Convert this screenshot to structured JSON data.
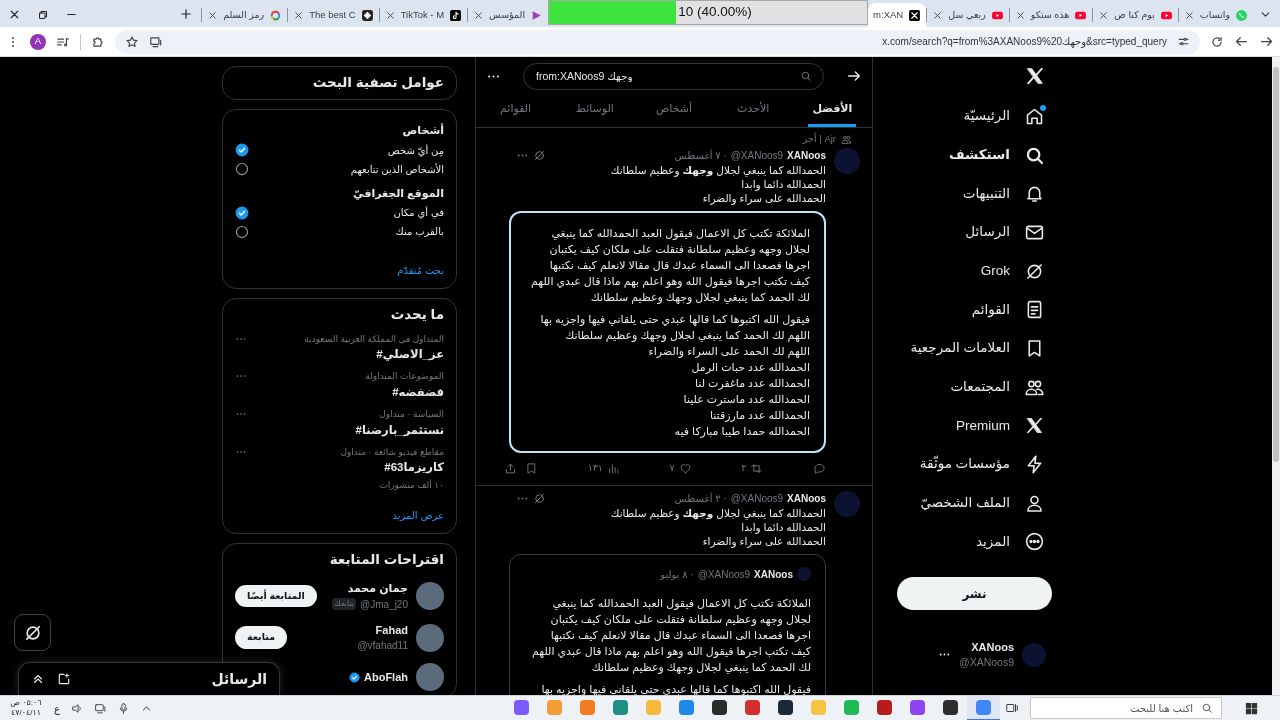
{
  "browser": {
    "tabs": [
      {
        "title": "واتساب",
        "selected": false
      },
      {
        "title": "يوم كنا ص",
        "selected": false
      },
      {
        "title": "هذه ستكو",
        "selected": false
      },
      {
        "title": "ربعي سل",
        "selected": false
      },
      {
        "title": "m:XAN",
        "selected": true
      },
      {
        "title": "المؤسس",
        "selected": false
      },
      {
        "title": "TikTok - M",
        "selected": false
      },
      {
        "title": "The best C",
        "selected": false
      },
      {
        "title": "رمز السلم",
        "selected": false
      }
    ],
    "progress": {
      "label": "10 (40.00%)",
      "level": 0.4
    },
    "url": "x.com/search?q=from%3AXANoos9%20وجهك&src=typed_query",
    "profile_initial": "A"
  },
  "nav": {
    "items": [
      {
        "label": "الرئيسيّة",
        "selected": false,
        "unread": true
      },
      {
        "label": "استكشف",
        "selected": true,
        "unread": false
      },
      {
        "label": "التنبيهات",
        "selected": false,
        "unread": false
      },
      {
        "label": "الرسائل",
        "selected": false,
        "unread": false
      },
      {
        "label": "Grok",
        "selected": false,
        "unread": false
      },
      {
        "label": "القوائم",
        "selected": false,
        "unread": false
      },
      {
        "label": "العلامات المرجعية",
        "selected": false,
        "unread": false
      },
      {
        "label": "المجتمعات",
        "selected": false,
        "unread": false
      },
      {
        "label": "Premium",
        "selected": false,
        "unread": false
      },
      {
        "label": "مؤسسات موثّقة",
        "selected": false,
        "unread": false
      },
      {
        "label": "الملف الشخصيّ",
        "selected": false,
        "unread": false
      },
      {
        "label": "المزيد",
        "selected": false,
        "unread": false
      }
    ],
    "post_button": "نشر",
    "account": {
      "name": "XANoos",
      "handle": "@XANoos9"
    }
  },
  "search": {
    "query": "from:XANoos9 وجهك",
    "tabs": [
      {
        "label": "الأفضل",
        "selected": true
      },
      {
        "label": "الأحدث",
        "selected": false
      },
      {
        "label": "أشخاص",
        "selected": false
      },
      {
        "label": "الوسائط",
        "selected": false
      },
      {
        "label": "القوائم",
        "selected": false
      }
    ]
  },
  "posts": [
    {
      "social_context": "Ajr | أجر",
      "name": "XANoos",
      "handle": "@XANoos9",
      "date": "· ٧ أغسطس",
      "text": "الحمدالله كما ينبغي لجلال **وجهك** وعظيم سلطانك\nالحمدالله دائما وابدا\nالحمدالله على سراء والضراء",
      "quote": {
        "highlighted": true,
        "paragraphs": [
          "الملائكة تكتب كل الاعمال فيقول العبد الحمدالله كما ينبغي\nلجلال وجهه وعظيم سلطانة فتقلت على ملكان كيف يكتبان\nاجرها فصعدا الى السماء عبدك قال مقالا لانعلم كيف نكتبها\nكيف تكتب اجرها فيقول الله وهو اعلم بهم ماذا قال عبدي اللهم\nلك الحمد كما ينبغي لجلال وجهك وعظيم سلطانك",
          "فيقول الله اكتبوها كما قالها عبدي حتى يلقاني فيها واجزيه بها\nاللهم لك الحمد كما ينبغي لجلال وجهك وعظيم سلطانك\nاللهم لك الحمد على السراء والضراء\nالحمدالله عدد حبات الرمل\nالحمدالله عدد ماغفرت لنا\nالحمدالله عدد ماسترت علينا\nالحمدالله عدد مارزقتنا\nالحمدالله حمدا طيبا مباركا فيه"
        ]
      },
      "stats": {
        "reposts": "٢",
        "likes": "٧",
        "views": "١٣١"
      }
    },
    {
      "name": "XANoos",
      "handle": "@XANoos9",
      "date": "· ٢ أغسطس",
      "text": "الحمدالله كما ينبغي لجلال **وجهك** وعظيم سلطانك\nالحمدالله دائما وابدا\nالحمدالله على سراء والضراء",
      "quote": {
        "highlighted": false,
        "name": "XANoos",
        "handle": "@XANoos9",
        "date": "· ٨ يوليو",
        "paragraphs": [
          "الملائكة تكتب كل الاعمال فيقول العبد الحمدالله كما ينبغي\nلجلال وجهه وعظيم سلطانة فتقلت على ملكان كيف يكتبان\nاجرها فصعدا الى السماء عبدك قال مقالا لانعلم كيف نكتبها\nكيف تكتب اجرها فيقول الله وهو اعلم بهم ماذا قال عبدي اللهم\nلك الحمد كما ينبغي لجلال وجهك وعظيم سلطانك",
          "فيقول الله اكتبوها كما قالها عبدي حتى يلقاني فيها واجزيه بها"
        ]
      }
    }
  ],
  "filters": {
    "title": "عوامل تصفية البحث",
    "groups": [
      {
        "heading": "أشخاص",
        "options": [
          {
            "label": "مِن أيّ شخص",
            "selected": true
          },
          {
            "label": "الأشخاص الذين تتابعهم",
            "selected": false
          }
        ]
      },
      {
        "heading": "الموقع الجغرافيّ",
        "options": [
          {
            "label": "في أي مكان",
            "selected": true
          },
          {
            "label": "بالقرب منك",
            "selected": false
          }
        ]
      }
    ],
    "advanced": "بحث مُتقدّم"
  },
  "trends": {
    "title": "ما يحدث",
    "items": [
      {
        "context": "المتداول في المملكة العربية السعودية",
        "tag": "#عز_الاصلي"
      },
      {
        "context": "الموضوعات المتداولة",
        "tag": "#فضفضه"
      },
      {
        "context": "السياسة · متداول",
        "tag": "#نستثمر_بارضنا"
      },
      {
        "context": "مقاطع فيديو شائعة · متداول",
        "tag": "#كاريزما63",
        "posts": "١٠ ألف منشورات"
      }
    ],
    "more": "عرض المزيد"
  },
  "suggestions": {
    "title": "اقتراحات المتابعة",
    "users": [
      {
        "name": "جمان محمد",
        "handle": "@Jma_j20",
        "badge": "يتابعك",
        "verified": false,
        "button": "المتابعة أيضًا"
      },
      {
        "name": "Fahad",
        "handle": "@vfahad11",
        "verified": false,
        "button": "متابعة"
      },
      {
        "name": "AboFlah",
        "verified": true
      }
    ]
  },
  "messages": {
    "title": "الرسائل"
  },
  "taskbar": {
    "time": "٠٥:٠٦ ص",
    "date": "٤٧/٠٤/١١",
    "language": "ع",
    "search_placeholder": "اكتب هنا للبحث",
    "apps": [
      {
        "color": "#7a5af8",
        "selected": false
      },
      {
        "color": "#f29d38",
        "selected": false
      },
      {
        "color": "#f47b20",
        "selected": false
      },
      {
        "color": "#1f8f84",
        "selected": false
      },
      {
        "color": "#f6b93b",
        "selected": false
      },
      {
        "color": "#1e88e5",
        "selected": false
      },
      {
        "color": "#2b2b2b",
        "selected": false
      },
      {
        "color": "#d32f2f",
        "selected": false
      },
      {
        "color": "#1b2838",
        "selected": false
      },
      {
        "color": "#f4c542",
        "selected": false
      },
      {
        "color": "#1db954",
        "selected": false
      },
      {
        "color": "#b71c1c",
        "selected": false
      },
      {
        "color": "#8e44ef",
        "selected": false
      },
      {
        "color": "#2d2d2d",
        "selected": false
      },
      {
        "color": "#4285f4",
        "selected": true
      }
    ]
  }
}
